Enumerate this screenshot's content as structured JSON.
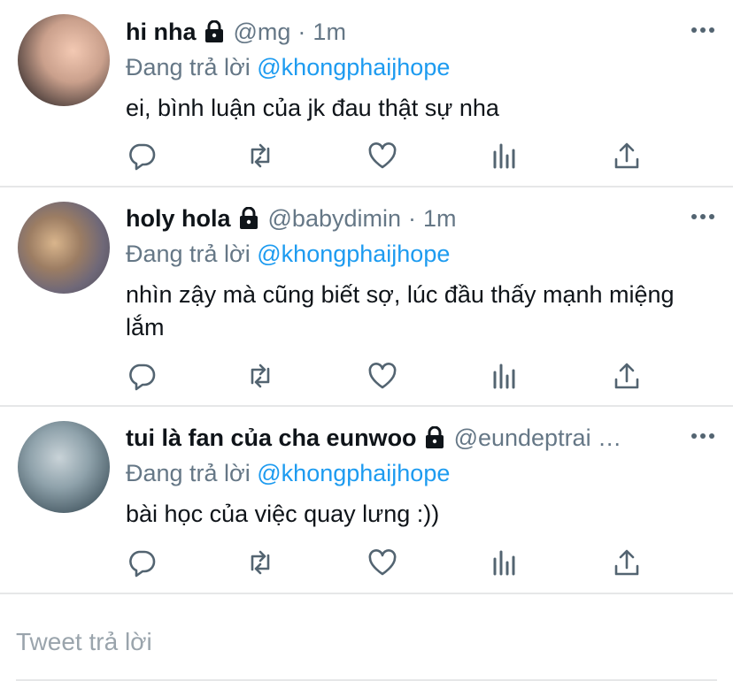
{
  "tweets": [
    {
      "name": "hi nha",
      "handle": "@mg",
      "dot": "·",
      "time": "1m",
      "replying_prefix": "Đang trả lời ",
      "replying_to": "@khongphaijhope",
      "text": "ei, bình luận của jk đau thật sự nha"
    },
    {
      "name": "holy hola",
      "handle": "@babydimin",
      "dot": "·",
      "time": "1m",
      "replying_prefix": "Đang trả lời ",
      "replying_to": "@khongphaijhope",
      "text": "nhìn zậy mà cũng biết sợ, lúc đầu thấy mạnh miệng lắm"
    },
    {
      "name": "tui là fan của cha eunwoo",
      "handle": "@eundeptrai …",
      "dot": "",
      "time": "",
      "replying_prefix": "Đang trả lời ",
      "replying_to": "@khongphaijhope",
      "text": "bài học của việc quay lưng :))"
    }
  ],
  "reply_box": {
    "placeholder": "Tweet trả lời"
  },
  "icons": {
    "more": "more-horizontal-icon",
    "lock": "lock-icon",
    "reply": "reply-bubble-icon",
    "retweet": "retweet-icon",
    "like": "heart-icon",
    "analytics": "analytics-bars-icon",
    "share": "share-upload-icon"
  },
  "colors": {
    "link": "#1d9bf0",
    "secondary": "#657786",
    "text": "#0f1419",
    "divider": "#e6e7e8"
  }
}
